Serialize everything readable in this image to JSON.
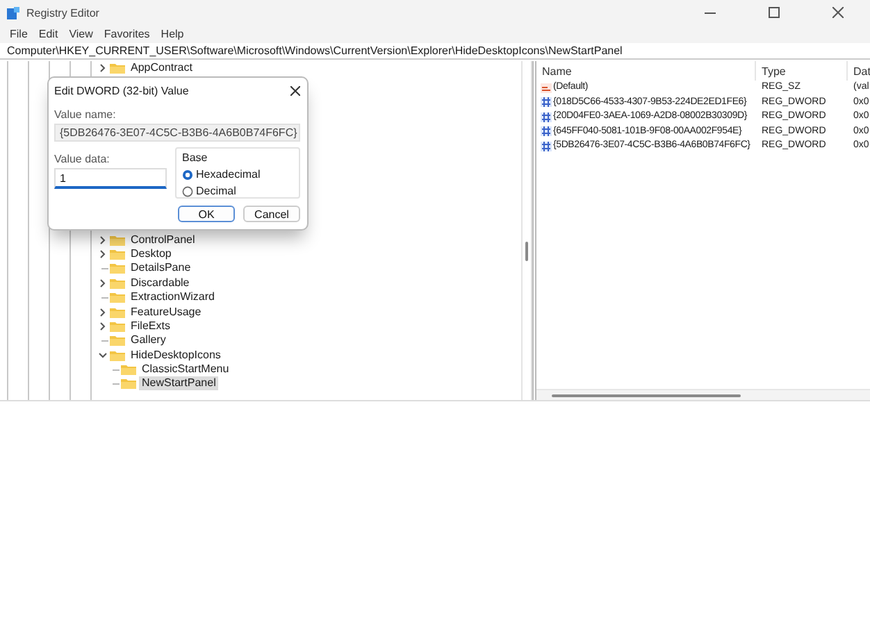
{
  "window": {
    "title": "Registry Editor"
  },
  "menu": [
    "File",
    "Edit",
    "View",
    "Favorites",
    "Help"
  ],
  "address": "Computer\\HKEY_CURRENT_USER\\Software\\Microsoft\\Windows\\CurrentVersion\\Explorer\\HideDesktopIcons\\NewStartPanel",
  "tree": {
    "top_items": [
      {
        "label": "AppContract",
        "has_children": true,
        "expanded": false,
        "selected": false
      }
    ],
    "items": [
      {
        "label": "ControlPanel",
        "has_children": true,
        "expanded": false,
        "selected": false
      },
      {
        "label": "Desktop",
        "has_children": true,
        "expanded": false,
        "selected": false
      },
      {
        "label": "DetailsPane",
        "has_children": false,
        "selected": false
      },
      {
        "label": "Discardable",
        "has_children": true,
        "expanded": false,
        "selected": false
      },
      {
        "label": "ExtractionWizard",
        "has_children": false,
        "selected": false
      },
      {
        "label": "FeatureUsage",
        "has_children": true,
        "expanded": false,
        "selected": false
      },
      {
        "label": "FileExts",
        "has_children": true,
        "expanded": false,
        "selected": false
      },
      {
        "label": "Gallery",
        "has_children": false,
        "selected": false
      },
      {
        "label": "HideDesktopIcons",
        "has_children": true,
        "expanded": true,
        "selected": false,
        "children": [
          {
            "label": "ClassicStartMenu",
            "has_children": false,
            "selected": false
          },
          {
            "label": "NewStartPanel",
            "has_children": false,
            "selected": true
          }
        ]
      }
    ]
  },
  "values": {
    "columns": [
      "Name",
      "Type",
      "Dat"
    ],
    "rows": [
      {
        "kind": "string",
        "name": "(Default)",
        "type": "REG_SZ",
        "data": "(val"
      },
      {
        "kind": "dword",
        "name": "{018D5C66-4533-4307-9B53-224DE2ED1FE6}",
        "type": "REG_DWORD",
        "data": "0x0"
      },
      {
        "kind": "dword",
        "name": "{20D04FE0-3AEA-1069-A2D8-08002B30309D}",
        "type": "REG_DWORD",
        "data": "0x0"
      },
      {
        "kind": "dword",
        "name": "{645FF040-5081-101B-9F08-00AA002F954E}",
        "type": "REG_DWORD",
        "data": "0x0"
      },
      {
        "kind": "dword",
        "name": "{5DB26476-3E07-4C5C-B3B6-4A6B0B74F6FC}",
        "type": "REG_DWORD",
        "data": "0x0"
      }
    ]
  },
  "dialog": {
    "title": "Edit DWORD (32-bit) Value",
    "value_name_label": "Value name:",
    "value_name": "{5DB26476-3E07-4C5C-B3B6-4A6B0B74F6FC}",
    "value_data_label": "Value data:",
    "value_data": "1",
    "base_label": "Base",
    "base_options": [
      {
        "label": "Hexadecimal",
        "selected": true
      },
      {
        "label": "Decimal",
        "selected": false
      }
    ],
    "buttons": [
      {
        "label": "OK",
        "default": true
      },
      {
        "label": "Cancel",
        "default": false
      }
    ]
  }
}
